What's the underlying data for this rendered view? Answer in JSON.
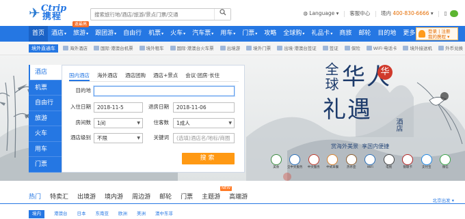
{
  "header": {
    "logo_en": "Ctrip",
    "logo_cn": "携程",
    "search_placeholder": "搜索旅行地/酒店/旅游/景点门票/交通",
    "language": "Language",
    "service": "客服中心",
    "domestic": "境内",
    "phone": "400-830-6666"
  },
  "nav": {
    "items": [
      {
        "label": "首页",
        "caret": ""
      },
      {
        "label": "酒店",
        "caret": "▾"
      },
      {
        "label": "旅游",
        "caret": "▾"
      },
      {
        "label": "跟团游",
        "caret": "▾"
      },
      {
        "label": "自由行",
        "caret": ""
      },
      {
        "label": "机票",
        "caret": "▾"
      },
      {
        "label": "火车",
        "caret": "▾"
      },
      {
        "label": "汽车票",
        "caret": "▾"
      },
      {
        "label": "用车",
        "caret": "▾"
      },
      {
        "label": "门票",
        "caret": "▾"
      },
      {
        "label": "攻略",
        "caret": ""
      },
      {
        "label": "全球购",
        "caret": "▾"
      },
      {
        "label": "礼品卡",
        "caret": "▾"
      },
      {
        "label": "商旅",
        "caret": ""
      },
      {
        "label": "邮轮",
        "caret": ""
      },
      {
        "label": "目的地",
        "caret": ""
      },
      {
        "label": "更多",
        "caret": "▾"
      }
    ],
    "tag": "返最高",
    "login_line1": "登录 | 注册",
    "login_line2": "我的携程 ▾"
  },
  "subnav": {
    "label": "境外直通车",
    "links": [
      "海外酒店",
      "国际·港澳台机票",
      "境外租车",
      "国际·港澳台火车票",
      "出境游",
      "境外门票",
      "出境·港澳台签证",
      "签证",
      "保险",
      "WiFi·电话卡",
      "境外接送机",
      "外币兑换"
    ]
  },
  "booking": {
    "side_items": [
      "酒店",
      "机票",
      "自由行",
      "旅游",
      "火车",
      "用车",
      "门票"
    ],
    "tabs": [
      "国内酒店",
      "海外酒店",
      "酒店团购",
      "酒店+景点",
      "会议·团房·长住"
    ],
    "destination_label": "目的地",
    "checkin_label": "入住日期",
    "checkin_value": "2018-11-5",
    "checkout_label": "退房日期",
    "checkout_value": "2018-11-06",
    "rooms_label": "房间数",
    "rooms_value": "1间",
    "guests_label": "住客数",
    "guests_value": "1成人",
    "level_label": "酒店级别",
    "level_value": "不限",
    "keyword_label": "关键词",
    "keyword_placeholder": "(选填)酒店名/地标/商圈",
    "search_button": "搜索"
  },
  "promo": {
    "line1": "全球",
    "line2a": "华人",
    "line2b": "礼遇",
    "hotel": "酒店",
    "seal": "华",
    "slogan": "赏海外美景  享国内便捷",
    "badges": [
      "美食",
      "全中文服务",
      "中文服务",
      "中式早餐",
      "热水壶",
      "WiFi",
      "电视",
      "银联卡",
      "支付宝",
      "微信"
    ]
  },
  "colors": {
    "brand_blue": "#2577e3",
    "orange": "#ff9913"
  },
  "categories": {
    "items": [
      "热门",
      "特卖汇",
      "出境游",
      "境内游",
      "周边游",
      "邮轮",
      "门票",
      "主题游",
      "高端游"
    ],
    "hot_tag": "NEW",
    "city": "北京出发 ▾",
    "subs": [
      "境内",
      "港澳台",
      "日本",
      "东南亚",
      "欧洲",
      "美洲",
      "澳中东非"
    ]
  }
}
